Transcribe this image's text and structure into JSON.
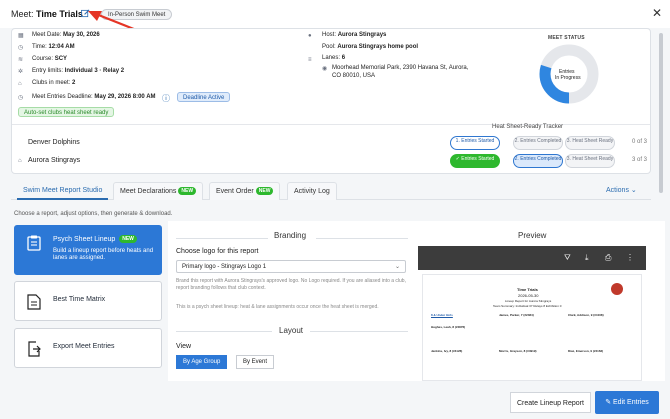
{
  "header": {
    "meet_label": "Meet:",
    "meet_name": "Time Trials",
    "swim_type": "In-Person Swim Meet"
  },
  "meet_info": {
    "meet_date_label": "Meet Date:",
    "meet_date": "May 30, 2026",
    "time_label": "Time:",
    "time": "12:04 AM",
    "course_label": "Course:",
    "course": "SCY",
    "entry_limits_label": "Entry limits:",
    "entry_limits": "Individual 3 · Relay 2",
    "clubs_label": "Clubs in meet:",
    "clubs": "2",
    "deadline_label": "Meet Entries Deadline:",
    "deadline": "May 29, 2026 8:00 AM",
    "deadline_badge": "Deadline Active",
    "auto_set_badge": "Auto-set clubs heat sheet ready",
    "host_label": "Host:",
    "host": "Aurora Stingrays",
    "pool_label": "Pool:",
    "pool": "Aurora Stingrays home pool",
    "lanes_label": "Lanes:",
    "lanes": "6",
    "address_line1": "Moorhead Memorial Park, 2390 Havana St, Aurora,",
    "address_line2": "CO 80010, USA"
  },
  "meet_status": {
    "title": "MEET STATUS",
    "line1": "Entries",
    "line2": "In Progress",
    "progress_fraction": 0.3,
    "colors": {
      "progress": "#2f86e0",
      "track": "#e5e7eb"
    }
  },
  "tracker": {
    "title": "Heat Sheet-Ready Tracker",
    "clubs": [
      {
        "name": "Denver Dolphins",
        "steps": [
          "1. Entries Started",
          "2. Entries Completed",
          "3. Heat Sheet Ready"
        ],
        "count": "0 of 3"
      },
      {
        "name": "Aurora Stingrays",
        "steps": [
          "✓ Entries Started",
          "2. Entries Completed",
          "3. Heat Sheet Ready"
        ],
        "count": "3 of 3"
      }
    ]
  },
  "tabs": [
    {
      "label": "Swim Meet Report Studio"
    },
    {
      "label": "Meet Declarations",
      "badge": "NEW"
    },
    {
      "label": "Event Order",
      "badge": "NEW"
    },
    {
      "label": "Activity Log"
    }
  ],
  "actions_label": "Actions",
  "hint": "Choose a report, adjust options, then generate & download.",
  "reports": [
    {
      "title": "Psych Sheet Lineup",
      "badge": "NEW",
      "subtitle": "Build a lineup report before heats and lanes are assigned."
    },
    {
      "title": "Best Time Matrix"
    },
    {
      "title": "Export Meet Entries"
    }
  ],
  "branding": {
    "heading": "Branding",
    "logo_label": "Choose logo for this report",
    "logo_value": "Primary logo - Stingrays Logo 1",
    "note": "Brand this report with Aurora Stingrays's approved logo. No Logo required. If you are aliased into a club, report branding follows that club context.",
    "desc": "This is a psych sheet lineup: heat & lane assignments occur once the heat sheet is merged."
  },
  "layout": {
    "heading": "Layout",
    "view_label": "View",
    "options": [
      "By Age Group",
      "By Event"
    ]
  },
  "preview": {
    "heading": "Preview",
    "doc": {
      "title": "Time Trials",
      "date": "2026-05-30",
      "subtitle": "Lineup Report for Aurora Stingrays",
      "summary": "Team Summary: Individual 37 Relays 8 Exhibition 0",
      "group": "8 & Under Girls",
      "names": [
        "James, Parker, 7 (#2484)",
        "Clark, Addison, 9 (#4108)",
        "Hughes, Leah, 8 (#4876)",
        "Jenkins, Ivy, 8 (#4126)",
        "Morris, Grayson, 8 (#4919)",
        "Diaz, Emerson, 9 (#4162)"
      ]
    }
  },
  "footer": {
    "create_label": "Create Lineup Report",
    "edit_label": "Edit Entries"
  }
}
